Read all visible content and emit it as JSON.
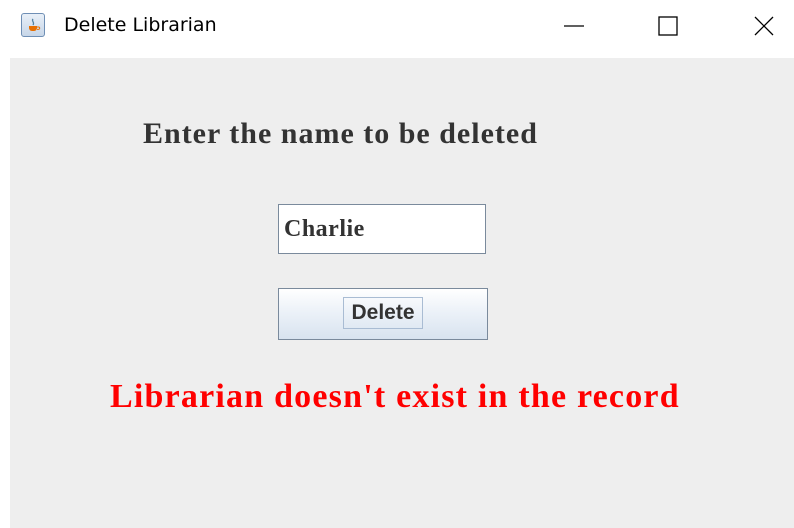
{
  "window": {
    "title": "Delete Librarian",
    "app_icon": "java-icon",
    "controls": [
      "minimize-icon",
      "maximize-icon",
      "close-icon"
    ]
  },
  "form": {
    "heading": "Enter the name to be deleted",
    "name_value": "Charlie",
    "delete_label": "Delete"
  },
  "status": {
    "message": "Librarian doesn't exist in the record",
    "color": "#ff0000"
  },
  "colors": {
    "panel_background": "#eeeeee",
    "text": "#333333"
  }
}
